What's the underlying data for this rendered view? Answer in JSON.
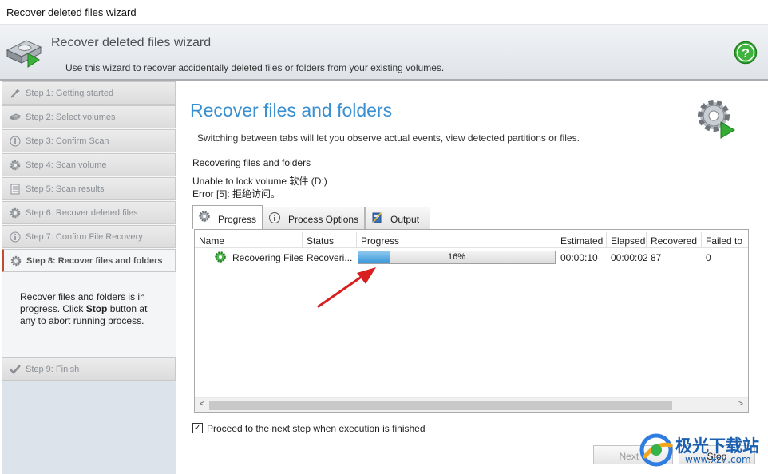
{
  "window": {
    "title": "Recover deleted files wizard"
  },
  "header": {
    "title": "Recover deleted files wizard",
    "subtitle": "Use this wizard to recover accidentally deleted files or folders from your existing volumes."
  },
  "sidebar": {
    "steps": [
      {
        "label": "Step 1: Getting started",
        "icon": "wand-icon",
        "state": "done"
      },
      {
        "label": "Step 2: Select volumes",
        "icon": "drive-icon",
        "state": "done"
      },
      {
        "label": "Step 3: Confirm Scan",
        "icon": "info-icon",
        "state": "done"
      },
      {
        "label": "Step 4: Scan volume",
        "icon": "gear-icon",
        "state": "done"
      },
      {
        "label": "Step 5: Scan results",
        "icon": "list-icon",
        "state": "done"
      },
      {
        "label": "Step 6: Recover deleted files",
        "icon": "gear-icon",
        "state": "done"
      },
      {
        "label": "Step 7: Confirm File Recovery",
        "icon": "info-icon",
        "state": "done"
      },
      {
        "label": "Step 8: Recover files and folders",
        "icon": "gear-icon",
        "state": "active"
      },
      {
        "label": "Step 9: Finish",
        "icon": "checkmark-icon",
        "state": "pending"
      }
    ],
    "description": {
      "before": "Recover files and folders is in progress. Click ",
      "bold": "Stop",
      "after": " button at any to abort running process."
    }
  },
  "main": {
    "title": "Recover files and folders",
    "subtitle": "Switching between tabs will let you observe actual events, view detected partitions or files.",
    "section_title": "Recovering files and folders",
    "message_line1": "Unable to lock volume 软件 (D:)",
    "message_line2": "Error [5]: 拒绝访问。",
    "tabs": [
      {
        "label": "Progress",
        "icon": "gear-icon",
        "active": true
      },
      {
        "label": "Process Options",
        "icon": "info-icon",
        "active": false
      },
      {
        "label": "Output",
        "icon": "notebook-icon",
        "active": false
      }
    ],
    "grid": {
      "columns": [
        "Name",
        "Status",
        "Progress",
        "Estimated",
        "Elapsed",
        "Recovered",
        "Failed to"
      ],
      "rows": [
        {
          "name": "Recovering Files",
          "status": "Recoveri...",
          "progress_text": "16%",
          "progress_fraction": 0.16,
          "estimated": "00:00:10",
          "elapsed": "00:00:02",
          "recovered": "87",
          "failed": "0"
        }
      ],
      "scroll_left": "<",
      "scroll_right": ">"
    },
    "proceed_checkbox": {
      "label": "Proceed to the next step when execution is finished",
      "checked": true,
      "mark": "✓"
    },
    "buttons": {
      "next": "Next >",
      "stop": "Stop"
    }
  },
  "watermark": {
    "text": "极光下载站",
    "url": "www.xz7.com"
  },
  "colors": {
    "accent_title": "#3a8fd0",
    "active_marker": "#c14a2f",
    "progress_fill": "#3796d8",
    "arrow": "#d81e1e"
  }
}
